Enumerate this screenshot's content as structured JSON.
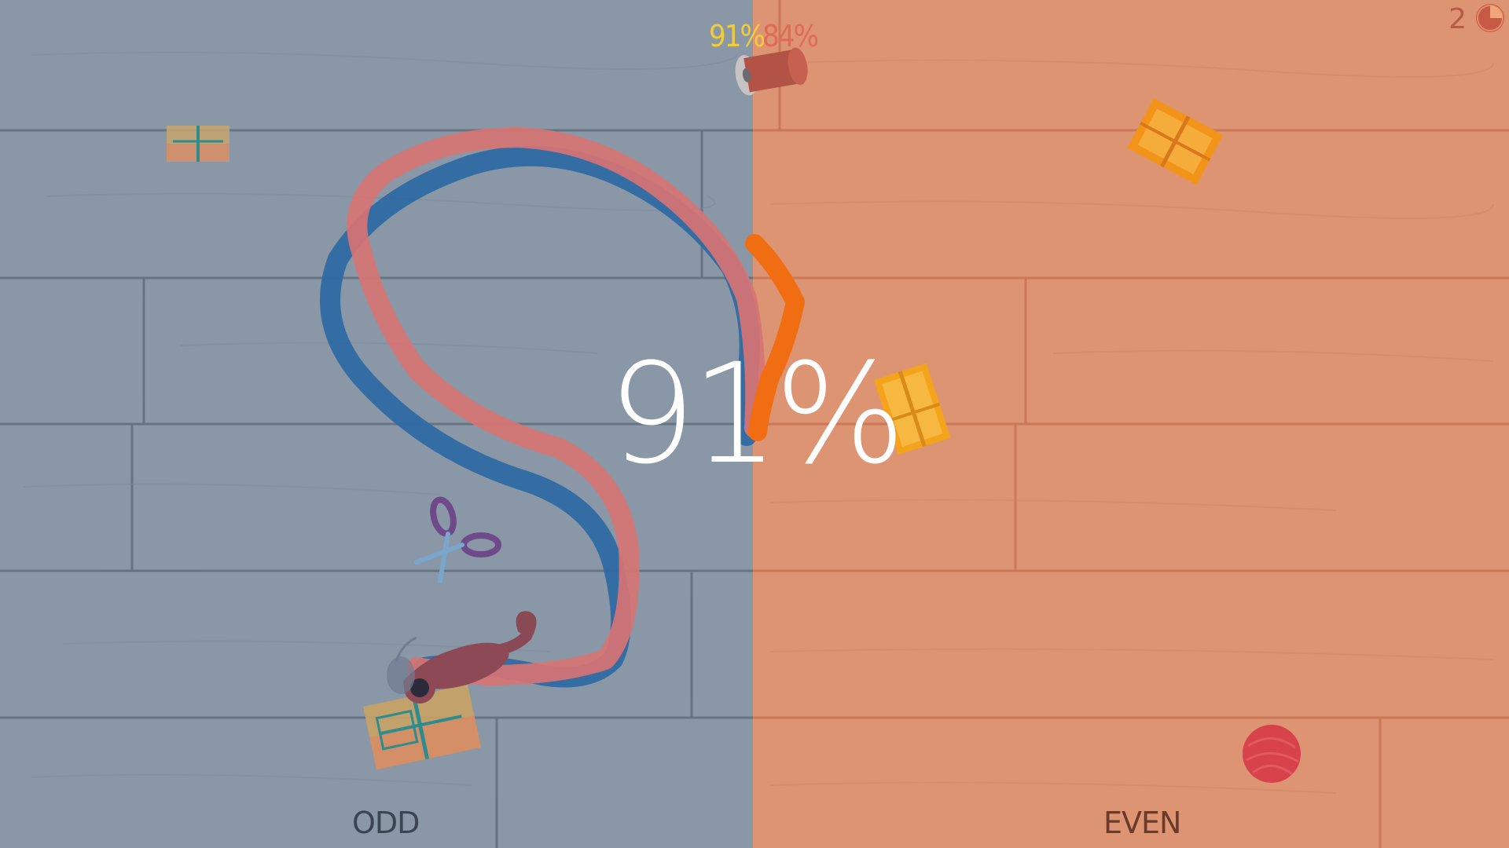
{
  "hud": {
    "odd_score": "91%",
    "even_score": "84%",
    "round_number": "2",
    "timer_fraction_remaining": 0.25
  },
  "result": {
    "big_percent": "91%"
  },
  "sides": {
    "odd_label": "ODD",
    "even_label": "EVEN"
  },
  "colors": {
    "odd_floor": "#8a97a6",
    "even_floor": "#dd9472",
    "plank_line_odd": "#5b6877",
    "plank_line_even": "#c8714f",
    "blue_trail": "#2f6aa2",
    "red_trail": "#d67474",
    "orange_trail": "#f06d12"
  },
  "icons": [
    "gift-box-icon",
    "spool-icon",
    "scissors-icon",
    "cat-icon",
    "yarn-ball-icon",
    "pie-timer-icon"
  ]
}
